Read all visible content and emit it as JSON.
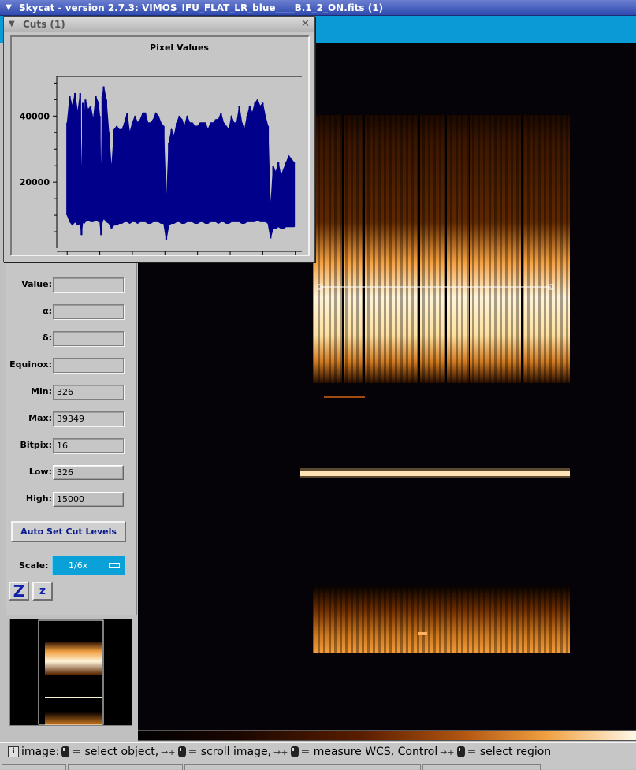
{
  "window": {
    "title": "Skycat - version 2.7.3: VIMOS_IFU_FLAT_LR_blue____B.1_2_ON.fits (1)"
  },
  "info_panel": {
    "fields": [
      {
        "label": "Value:",
        "value": ""
      },
      {
        "label": "α:",
        "value": ""
      },
      {
        "label": "δ:",
        "value": ""
      },
      {
        "label": "Equinox:",
        "value": ""
      },
      {
        "label": "Min:",
        "value": "326"
      },
      {
        "label": "Max:",
        "value": "39349"
      },
      {
        "label": "Bitpix:",
        "value": "16"
      },
      {
        "label": "Low:",
        "value": "326"
      },
      {
        "label": "High:",
        "value": "15000"
      }
    ],
    "auto_set_label": "Auto Set Cut Levels",
    "scale_label": "Scale:",
    "scale_value": "1/6x",
    "zoom_in_label": "Z",
    "zoom_out_label": "z"
  },
  "status_bar": {
    "prefix": "image:",
    "part1": "= select object,",
    "part2": "= scroll image,",
    "part3": "= measure WCS, Control",
    "part4": "= select region"
  },
  "cuts_window": {
    "title": "Cuts (1)",
    "close_glyph": "✕"
  },
  "colors": {
    "plot_line": "#00008b",
    "title_bar": "#2f4ab0",
    "accent_band": "#0a9ad6"
  },
  "chart_data": {
    "type": "line",
    "title": "Pixel Values",
    "xlabel": "",
    "ylabel": "",
    "xlim": [
      -80,
      1800
    ],
    "ylim": [
      0,
      52000
    ],
    "xticks": [
      0,
      500,
      1000,
      1500
    ],
    "yticks": [
      20000,
      40000
    ],
    "series": [
      {
        "x": [
          0,
          20,
          40,
          60,
          80,
          100,
          110,
          120,
          130,
          140,
          160,
          180,
          200,
          220,
          240,
          250,
          260,
          270,
          280,
          300,
          320,
          340,
          360,
          380,
          400,
          420,
          440,
          460,
          480,
          500,
          520,
          540,
          560,
          580,
          600,
          620,
          640,
          660,
          680,
          700,
          720,
          740,
          760,
          780,
          800,
          820,
          840,
          860,
          880,
          900,
          920,
          940,
          960,
          980,
          1000,
          1020,
          1040,
          1060,
          1080,
          1100,
          1120,
          1140,
          1160,
          1180,
          1200,
          1220,
          1240,
          1260,
          1280,
          1300,
          1320,
          1340,
          1360,
          1380,
          1400,
          1420,
          1440,
          1460,
          1480,
          1500,
          1520,
          1540,
          1560,
          1580,
          1600,
          1620,
          1640,
          1660,
          1680,
          1700,
          1720,
          1740
        ],
        "y_high": [
          38000,
          46000,
          43000,
          47000,
          41000,
          47000,
          18000,
          44000,
          39000,
          45000,
          42000,
          43000,
          39000,
          46000,
          44000,
          40000,
          20000,
          46000,
          49000,
          45000,
          35000,
          24000,
          36000,
          37000,
          36000,
          36000,
          38000,
          41000,
          35000,
          38000,
          40000,
          38000,
          39000,
          41000,
          41000,
          38000,
          38000,
          39000,
          41000,
          40000,
          38000,
          37000,
          14000,
          32000,
          36000,
          34000,
          38000,
          40000,
          39000,
          37000,
          40000,
          38000,
          38000,
          37000,
          37000,
          38000,
          38000,
          38000,
          36000,
          38000,
          38000,
          39000,
          39000,
          41000,
          38000,
          37000,
          36000,
          40000,
          38000,
          38000,
          43000,
          38000,
          36000,
          40000,
          43000,
          41000,
          44000,
          45000,
          43000,
          44000,
          40000,
          37000,
          12000,
          25000,
          23000,
          26000,
          22000,
          24000,
          26000,
          28000,
          27000,
          26000
        ],
        "y_low": [
          10000,
          8000,
          7000,
          8000,
          7000,
          7500,
          4000,
          8000,
          7500,
          8000,
          8500,
          8000,
          8000,
          8500,
          8000,
          8000,
          4000,
          8000,
          9000,
          8000,
          7500,
          6000,
          7000,
          7000,
          7500,
          7500,
          8000,
          8000,
          7500,
          8000,
          8000,
          7500,
          8000,
          8000,
          8000,
          7500,
          7500,
          8000,
          8000,
          8000,
          7500,
          7500,
          2500,
          7000,
          7500,
          7500,
          8000,
          8000,
          7500,
          7500,
          8000,
          8000,
          8000,
          7500,
          7500,
          8000,
          8000,
          7500,
          7500,
          8000,
          8000,
          8000,
          7500,
          8000,
          8000,
          7500,
          7500,
          8000,
          8000,
          8000,
          8000,
          7500,
          7500,
          8000,
          8000,
          8000,
          8000,
          8500,
          8000,
          8000,
          8000,
          7500,
          3000,
          6000,
          6000,
          6500,
          6000,
          6000,
          6500,
          6500,
          6500,
          6500
        ]
      }
    ]
  }
}
